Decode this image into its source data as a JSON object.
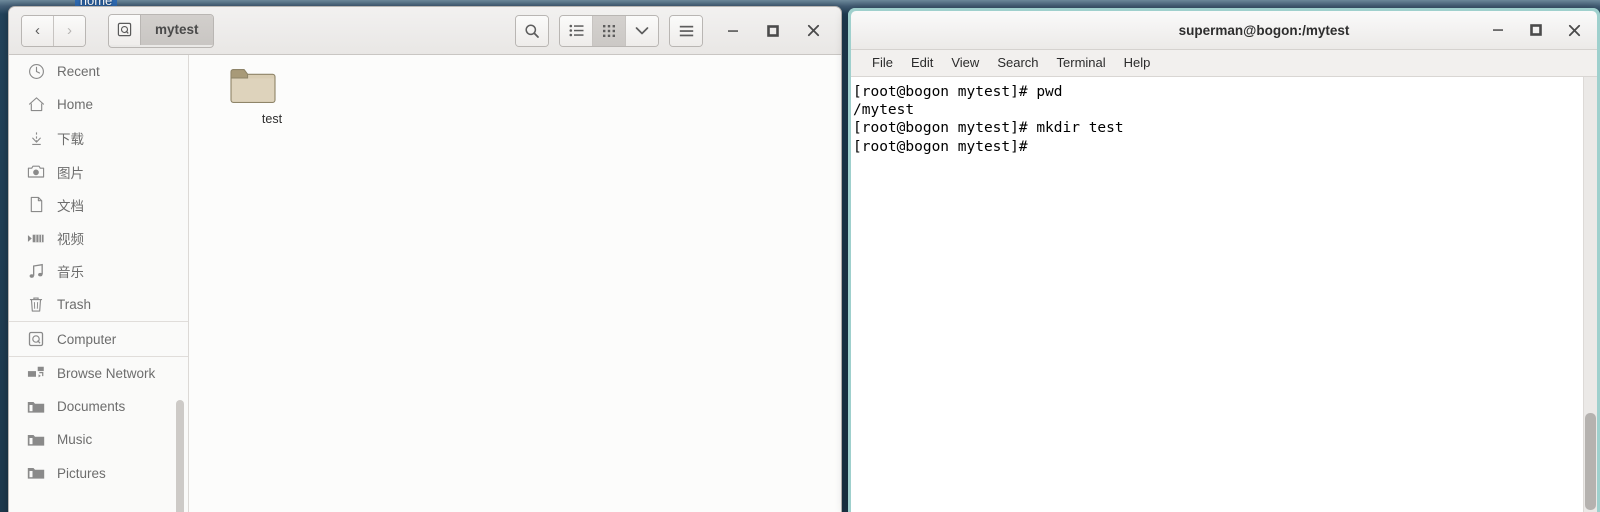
{
  "desktop": {
    "icons": [
      {
        "label": "home",
        "name": "desktop-icon-home"
      }
    ],
    "background_color": "#1e3a4e"
  },
  "file_manager": {
    "window_name": "file-manager-window",
    "nav": {
      "back_label": "‹",
      "forward_label": "›"
    },
    "pathbar": {
      "icon": "computer-disk-icon",
      "crumb": "mytest"
    },
    "toolbar": {
      "search_icon": "search-icon",
      "list_view_icon": "list-view-icon",
      "grid_view_icon": "grid-view-icon",
      "view_options_icon": "chevron-down-icon",
      "menu_icon": "hamburger-menu-icon",
      "minimize_label": "–",
      "maximize_label": "□",
      "close_label": "✕"
    },
    "sidebar": {
      "items": [
        {
          "label": "Recent",
          "icon": "clock-icon",
          "state": "normal"
        },
        {
          "label": "Home",
          "icon": "home-icon",
          "state": "normal"
        },
        {
          "label": "下载",
          "icon": "download-icon",
          "state": "normal"
        },
        {
          "label": "图片",
          "icon": "camera-icon",
          "state": "normal"
        },
        {
          "label": "文档",
          "icon": "document-icon",
          "state": "normal"
        },
        {
          "label": "视频",
          "icon": "video-icon",
          "state": "normal"
        },
        {
          "label": "音乐",
          "icon": "music-icon",
          "state": "normal"
        },
        {
          "label": "Trash",
          "icon": "trash-icon",
          "state": "normal"
        },
        {
          "label": "Computer",
          "icon": "computer-icon",
          "state": "hovered"
        },
        {
          "label": "Browse Network",
          "icon": "network-icon",
          "state": "normal"
        },
        {
          "label": "Documents",
          "icon": "folder-icon",
          "state": "normal"
        },
        {
          "label": "Music",
          "icon": "folder-icon",
          "state": "normal"
        },
        {
          "label": "Pictures",
          "icon": "folder-icon",
          "state": "normal"
        }
      ]
    },
    "content": {
      "files": [
        {
          "name": "test",
          "type": "folder"
        }
      ]
    }
  },
  "terminal": {
    "window_name": "terminal-window",
    "title": "superman@bogon:/mytest",
    "window_buttons": {
      "minimize_label": "–",
      "maximize_label": "□",
      "close_label": "✕"
    },
    "menu": [
      "File",
      "Edit",
      "View",
      "Search",
      "Terminal",
      "Help"
    ],
    "lines": [
      "[root@bogon mytest]# pwd",
      "/mytest",
      "[root@bogon mytest]# mkdir test",
      "[root@bogon mytest]# "
    ],
    "border_color": "#9fd0cd"
  }
}
